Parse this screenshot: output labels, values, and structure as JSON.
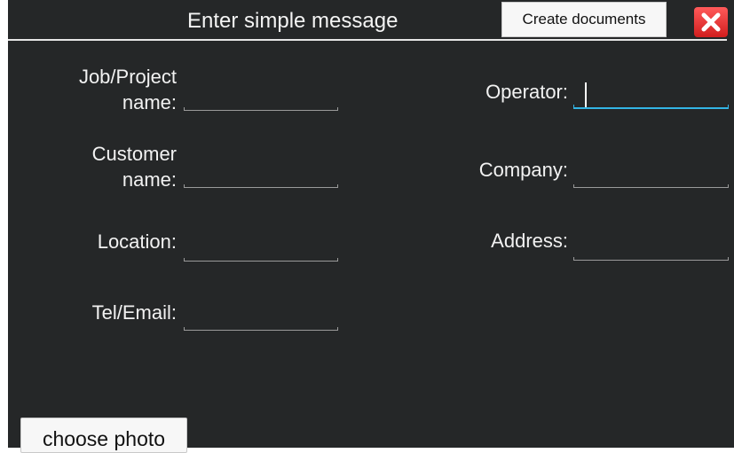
{
  "header": {
    "title": "Enter simple message",
    "create_label": "Create documents",
    "close_icon": "close-x-icon"
  },
  "fields": {
    "job_project_label": "Job/Project\nname:",
    "job_project_value": "",
    "customer_label": "Customer\nname:",
    "customer_value": "",
    "location_label": "Location:",
    "location_value": "",
    "tel_email_label": "Tel/Email:",
    "tel_email_value": "",
    "operator_label": "Operator:",
    "operator_value": "",
    "company_label": "Company:",
    "company_value": "",
    "address_label": "Address:",
    "address_value": ""
  },
  "footer": {
    "photo_label": "choose photo"
  },
  "colors": {
    "background": "#252728",
    "accent": "#33b5e5",
    "close_button": "#e02424"
  }
}
